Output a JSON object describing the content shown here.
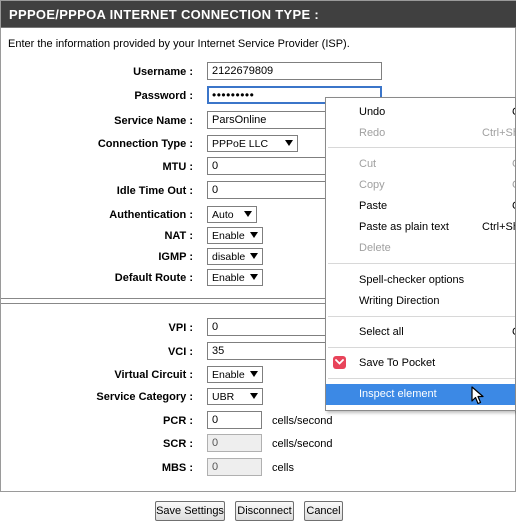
{
  "header": {
    "title": "PPPOE/PPPOA INTERNET CONNECTION TYPE :"
  },
  "intro": "Enter the information provided by your Internet Service Provider (ISP).",
  "form": {
    "username_label": "Username :",
    "username_value": "2122679809",
    "password_label": "Password :",
    "password_value": "•••••••••",
    "service_name_label": "Service Name :",
    "service_name_value": "ParsOnline",
    "connection_type_label": "Connection Type :",
    "connection_type_value": "PPPoE LLC",
    "mtu_label": "MTU :",
    "mtu_value": "0",
    "idle_label": "Idle Time Out :",
    "idle_value": "0",
    "auth_label": "Authentication :",
    "auth_value": "Auto",
    "nat_label": "NAT :",
    "nat_value": "Enable",
    "igmp_label": "IGMP :",
    "igmp_value": "disable",
    "default_route_label": "Default Route :",
    "default_route_value": "Enable"
  },
  "atm": {
    "vpi_label": "VPI :",
    "vpi_value": "0",
    "vci_label": "VCI :",
    "vci_value": "35",
    "virtual_circuit_label": "Virtual Circuit :",
    "virtual_circuit_value": "Enable",
    "service_category_label": "Service Category :",
    "service_category_value": "UBR",
    "pcr_label": "PCR :",
    "pcr_value": "0",
    "pcr_unit": "cells/second",
    "scr_label": "SCR :",
    "scr_value": "0",
    "scr_unit": "cells/second",
    "mbs_label": "MBS :",
    "mbs_value": "0",
    "mbs_unit": "cells"
  },
  "buttons": {
    "save": "Save Settings",
    "disconnect": "Disconnect",
    "cancel": "Cancel"
  },
  "context_menu": {
    "undo": "Undo",
    "undo_sc": "C",
    "redo": "Redo",
    "redo_sc": "Ctrl+Sh",
    "cut": "Cut",
    "cut_sc": "C",
    "copy": "Copy",
    "copy_sc": "C",
    "paste": "Paste",
    "paste_sc": "C",
    "paste_plain": "Paste as plain text",
    "paste_plain_sc": "Ctrl+Sh",
    "delete": "Delete",
    "spell": "Spell-checker options",
    "writing": "Writing Direction",
    "select_all": "Select all",
    "select_all_sc": "C",
    "pocket": "Save To Pocket",
    "inspect": "Inspect element",
    "highlight_color": "#3c89e5",
    "pocket_color": "#e8445a"
  }
}
